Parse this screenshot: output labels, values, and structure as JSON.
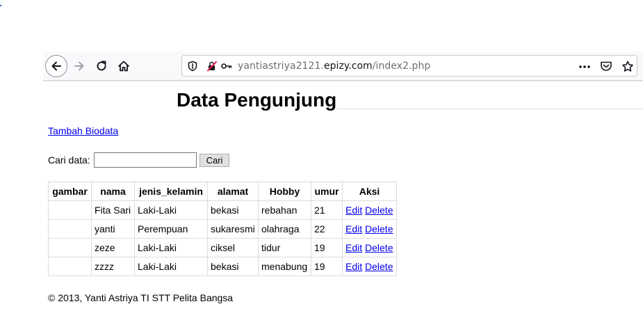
{
  "browser": {
    "url_prefix": "yantiastriya2121.",
    "url_domain": "epizy.com",
    "url_path": "/index2.php"
  },
  "page": {
    "title": "Data Pengunjung",
    "add_link": "Tambah Biodata",
    "search_label": "Cari data:",
    "search_value": "",
    "search_button": "Cari",
    "footer": "© 2013, Yanti Astriya TI STT Pelita Bangsa"
  },
  "table": {
    "headers": [
      "gambar",
      "nama",
      "jenis_kelamin",
      "alamat",
      "Hobby",
      "umur",
      "Aksi"
    ],
    "rows": [
      {
        "gambar": "",
        "nama": "Fita Sari",
        "jenis_kelamin": "Laki-Laki",
        "alamat": "bekasi",
        "hobby": "rebahan",
        "umur": "21",
        "edit": "Edit",
        "delete": "Delete"
      },
      {
        "gambar": "",
        "nama": "yanti",
        "jenis_kelamin": "Perempuan",
        "alamat": "sukaresmi",
        "hobby": "olahraga",
        "umur": "22",
        "edit": "Edit",
        "delete": "Delete"
      },
      {
        "gambar": "",
        "nama": "zeze",
        "jenis_kelamin": "Laki-Laki",
        "alamat": "ciksel",
        "hobby": "tidur",
        "umur": "19",
        "edit": "Edit",
        "delete": "Delete"
      },
      {
        "gambar": "",
        "nama": "zzzz",
        "jenis_kelamin": "Laki-Laki",
        "alamat": "bekasi",
        "hobby": "menabung",
        "umur": "19",
        "edit": "Edit",
        "delete": "Delete"
      }
    ]
  },
  "icons": {
    "back": "arrow-left-icon",
    "forward": "arrow-right-icon",
    "reload": "reload-icon",
    "home": "home-icon",
    "shield": "shield-icon",
    "insecure": "lock-slash-icon",
    "key": "key-icon",
    "more": "more-icon",
    "pocket": "pocket-icon",
    "bookmark": "star-icon"
  },
  "colors": {
    "link": "#0000ee",
    "toolbar": "#f9f9fb",
    "insecure_red": "#e22850"
  }
}
